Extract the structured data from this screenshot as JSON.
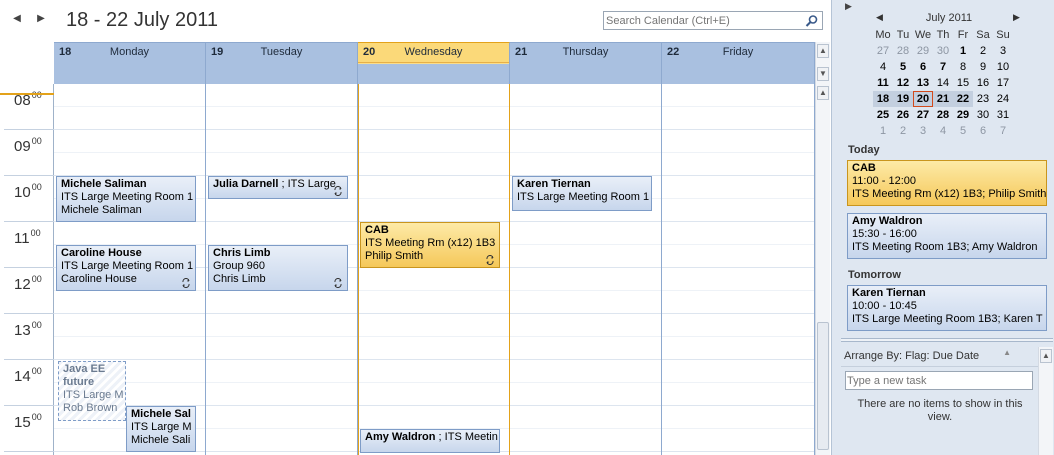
{
  "header": {
    "date_range": "18 - 22 July 2011",
    "search_placeholder": "Search Calendar (Ctrl+E)"
  },
  "days": [
    {
      "num": "18",
      "name": "Monday"
    },
    {
      "num": "19",
      "name": "Tuesday"
    },
    {
      "num": "20",
      "name": "Wednesday"
    },
    {
      "num": "21",
      "name": "Thursday"
    },
    {
      "num": "22",
      "name": "Friday"
    }
  ],
  "hours": [
    {
      "h": "08",
      "m": "00"
    },
    {
      "h": "09",
      "m": "00"
    },
    {
      "h": "10",
      "m": "00"
    },
    {
      "h": "11",
      "m": "00"
    },
    {
      "h": "12",
      "m": "00"
    },
    {
      "h": "13",
      "m": "00"
    },
    {
      "h": "14",
      "m": "00"
    },
    {
      "h": "15",
      "m": "00"
    }
  ],
  "appointments": [
    {
      "title": "Michele Saliman",
      "line2": "ITS Large Meeting Room 1",
      "line3": "Michele Saliman"
    },
    {
      "title": "Julia Darnell",
      "line2": " ; ITS Large"
    },
    {
      "title": "Karen Tiernan",
      "line2": "ITS Large Meeting Room 1"
    },
    {
      "title": "CAB",
      "line2": "ITS Meeting Rm (x12) 1B3",
      "line3": "Philip Smith"
    },
    {
      "title": "Caroline House",
      "line2": "ITS Large Meeting Room 1",
      "line3": "Caroline House"
    },
    {
      "title": "Chris Limb",
      "line2": "Group 960",
      "line3": "Chris Limb"
    },
    {
      "title": "Java EE future",
      "line2": "ITS Large M",
      "line3": "Rob Brown"
    },
    {
      "title": "Michele Sal",
      "line2": "ITS Large M",
      "line3": "Michele Sali"
    },
    {
      "title": "Amy Waldron",
      "line2": " ; ITS Meetin"
    }
  ],
  "mini_calendar": {
    "month": "July 2011",
    "dow": [
      "Mo",
      "Tu",
      "We",
      "Th",
      "Fr",
      "Sa",
      "Su"
    ],
    "weeks": [
      [
        "27",
        "28",
        "29",
        "30",
        "1",
        "2",
        "3"
      ],
      [
        "4",
        "5",
        "6",
        "7",
        "8",
        "9",
        "10"
      ],
      [
        "11",
        "12",
        "13",
        "14",
        "15",
        "16",
        "17"
      ],
      [
        "18",
        "19",
        "20",
        "21",
        "22",
        "23",
        "24"
      ],
      [
        "25",
        "26",
        "27",
        "28",
        "29",
        "30",
        "31"
      ],
      [
        "1",
        "2",
        "3",
        "4",
        "5",
        "6",
        "7"
      ]
    ]
  },
  "todo_bar": {
    "today_label": "Today",
    "tomorrow_label": "Tomorrow",
    "today_items": [
      {
        "title": "CAB",
        "time": "11:00 - 12:00",
        "where": "ITS Meeting Rm (x12) 1B3; Philip Smith"
      },
      {
        "title": "Amy Waldron",
        "time": "15:30 - 16:00",
        "where": "ITS Meeting Room 1B3; Amy Waldron"
      }
    ],
    "tomorrow_items": [
      {
        "title": "Karen Tiernan",
        "time": "10:00 - 10:45",
        "where": "ITS Large Meeting Room 1B3; Karen T"
      }
    ],
    "arrange_by": "Arrange By: Flag: Due Date",
    "task_placeholder": "Type a new task",
    "no_items": "There are no items to show in this view."
  },
  "colors": {
    "accent_today": "#e3a21a",
    "header_blue": "#a9c0e0",
    "appointment_blue": "#c7d6ec",
    "appointment_gold": "#f5c85a"
  }
}
